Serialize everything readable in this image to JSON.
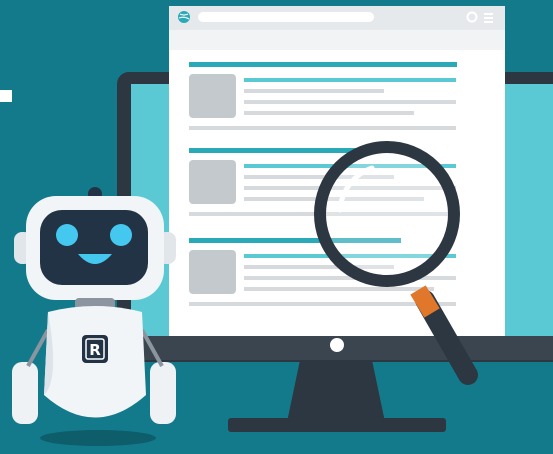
{
  "scene": {
    "colors": {
      "background": "#137a8c",
      "monitor_frame": "#2d3741",
      "monitor_screen": "#5bc9d3",
      "browser_window": "#ffffff",
      "browser_toolbar": "#e6e9ec",
      "accent_teal": "#2aa9b8",
      "placeholder_grey": "#c4c9ce",
      "text_line_grey": "#d6dadd",
      "magnifier_frame": "#2d3741",
      "magnifier_collar": "#e0772a",
      "robot_body": "#f2f5f8",
      "robot_face": "#233346",
      "robot_eyes": "#44c8f0"
    },
    "icons": [
      "globe-icon",
      "gear-icon",
      "menu-icon",
      "magnifying-glass-icon",
      "robot-mascot"
    ],
    "robot": {
      "badge_letter": "R"
    }
  }
}
